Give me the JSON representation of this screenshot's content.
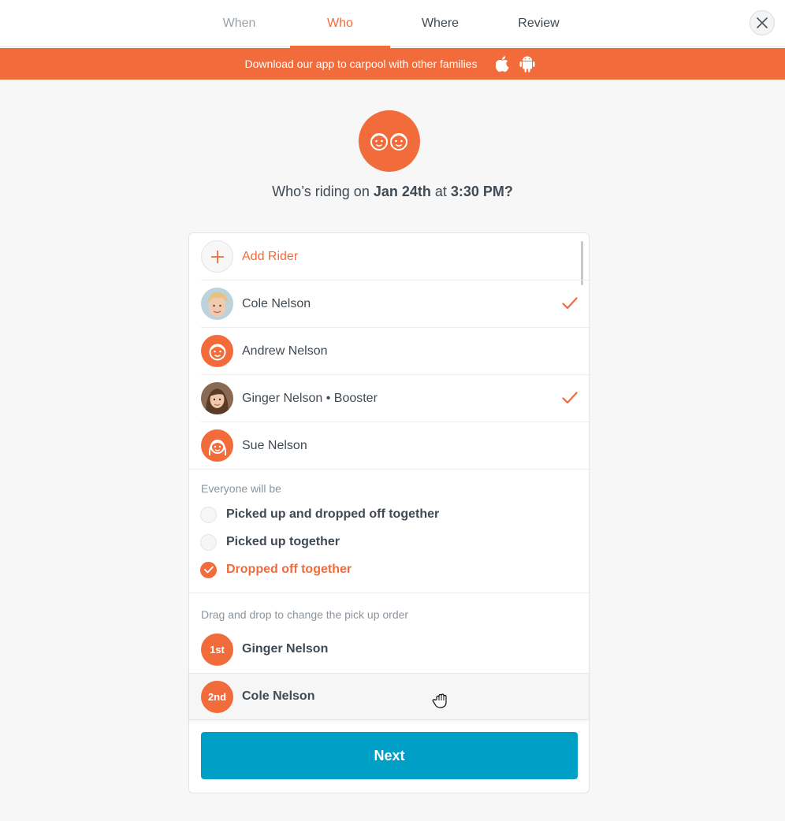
{
  "nav": {
    "tabs": [
      {
        "label": "When",
        "state": "done"
      },
      {
        "label": "Who",
        "state": "active"
      },
      {
        "label": "Where",
        "state": "upcoming"
      },
      {
        "label": "Review",
        "state": "upcoming"
      }
    ],
    "close_icon": "close-icon"
  },
  "banner": {
    "message": "Download our app to carpool with other families",
    "icons": [
      "apple-icon",
      "android-icon"
    ],
    "color": "#f26b3a"
  },
  "hero": {
    "icon": "kids-faces-icon",
    "question_prefix": "Who’s riding on ",
    "date": "Jan 24th",
    "middle": " at ",
    "time": "3:30 PM?"
  },
  "riders": {
    "add_label": "Add Rider",
    "list": [
      {
        "name": "Cole Nelson",
        "selected": true,
        "avatar": "photo"
      },
      {
        "name": "Andrew Nelson",
        "selected": false,
        "avatar": "boy-face-icon"
      },
      {
        "name": "Ginger Nelson • Booster",
        "selected": true,
        "avatar": "photo"
      },
      {
        "name": "Sue Nelson",
        "selected": false,
        "avatar": "girl-face-icon"
      }
    ]
  },
  "grouping": {
    "label": "Everyone will be",
    "options": [
      {
        "label": "Picked up and dropped off together",
        "selected": false
      },
      {
        "label": "Picked up together",
        "selected": false
      },
      {
        "label": "Dropped off together",
        "selected": true
      }
    ]
  },
  "order": {
    "label": "Drag and drop to change the pick up order",
    "items": [
      {
        "badge": "1st",
        "name": "Ginger Nelson"
      },
      {
        "badge": "2nd",
        "name": "Cole Nelson"
      }
    ]
  },
  "next_label": "Next",
  "colors": {
    "accent": "#f26b3a",
    "primary_button": "#00a0c6",
    "text": "#3f4a54"
  }
}
